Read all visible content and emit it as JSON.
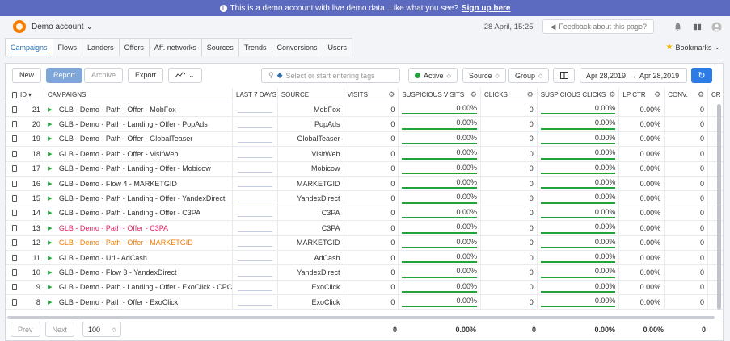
{
  "banner": {
    "text": "This is a demo account with live demo data. Like what you see?",
    "link": "Sign up here"
  },
  "topbar": {
    "account": "Demo account",
    "datetime": "28 April, 15:25",
    "feedback": "Feedback about this page?"
  },
  "tabs": [
    "Campaigns",
    "Flows",
    "Landers",
    "Offers",
    "Aff. networks",
    "Sources",
    "Trends",
    "Conversions",
    "Users"
  ],
  "bookmarks": "Bookmarks",
  "toolbar": {
    "new": "New",
    "report": "Report",
    "archive": "Archive",
    "export": "Export",
    "search_placeholder": "Select or start entering tags",
    "status": "Active",
    "source": "Source",
    "group": "Group",
    "date_from": "Apr 28,2019",
    "date_to": "Apr 28,2019"
  },
  "columns": {
    "id": "ID",
    "campaigns": "CAMPAIGNS",
    "last7": "LAST 7 DAYS",
    "source": "SOURCE",
    "visits": "VISITS",
    "susp_visits": "SUSPICIOUS VISITS",
    "clicks": "CLICKS",
    "susp_clicks": "SUSPICIOUS CLICKS",
    "lp_ctr": "LP CTR",
    "conv": "CONV.",
    "cr": "CR"
  },
  "rows": [
    {
      "id": "21",
      "name": "GLB - Demo - Path - Offer - MobFox",
      "source": "MobFox",
      "visits": "0",
      "susp_visits": "0.00%",
      "clicks": "0",
      "susp_clicks": "0.00%",
      "lp_ctr": "0.00%",
      "conv": "0",
      "color": ""
    },
    {
      "id": "20",
      "name": "GLB - Demo - Path - Landing - Offer - PopAds",
      "source": "PopAds",
      "visits": "0",
      "susp_visits": "0.00%",
      "clicks": "0",
      "susp_clicks": "0.00%",
      "lp_ctr": "0.00%",
      "conv": "0",
      "color": ""
    },
    {
      "id": "19",
      "name": "GLB - Demo - Path - Offer - GlobalTeaser",
      "source": "GlobalTeaser",
      "visits": "0",
      "susp_visits": "0.00%",
      "clicks": "0",
      "susp_clicks": "0.00%",
      "lp_ctr": "0.00%",
      "conv": "0",
      "color": ""
    },
    {
      "id": "18",
      "name": "GLB - Demo - Path - Offer - VisitWeb",
      "source": "VisitWeb",
      "visits": "0",
      "susp_visits": "0.00%",
      "clicks": "0",
      "susp_clicks": "0.00%",
      "lp_ctr": "0.00%",
      "conv": "0",
      "color": ""
    },
    {
      "id": "17",
      "name": "GLB - Demo - Path - Landing - Offer - Mobicow",
      "source": "Mobicow",
      "visits": "0",
      "susp_visits": "0.00%",
      "clicks": "0",
      "susp_clicks": "0.00%",
      "lp_ctr": "0.00%",
      "conv": "0",
      "color": ""
    },
    {
      "id": "16",
      "name": "GLB - Demo - Flow 4 - MARKETGID",
      "source": "MARKETGID",
      "visits": "0",
      "susp_visits": "0.00%",
      "clicks": "0",
      "susp_clicks": "0.00%",
      "lp_ctr": "0.00%",
      "conv": "0",
      "color": ""
    },
    {
      "id": "15",
      "name": "GLB - Demo - Path - Landing - Offer - YandexDirect",
      "source": "YandexDirect",
      "visits": "0",
      "susp_visits": "0.00%",
      "clicks": "0",
      "susp_clicks": "0.00%",
      "lp_ctr": "0.00%",
      "conv": "0",
      "color": ""
    },
    {
      "id": "14",
      "name": "GLB - Demo - Path - Landing - Offer - C3PA",
      "source": "C3PA",
      "visits": "0",
      "susp_visits": "0.00%",
      "clicks": "0",
      "susp_clicks": "0.00%",
      "lp_ctr": "0.00%",
      "conv": "0",
      "color": ""
    },
    {
      "id": "13",
      "name": "GLB - Demo - Path - Offer - C3PA",
      "source": "C3PA",
      "visits": "0",
      "susp_visits": "0.00%",
      "clicks": "0",
      "susp_clicks": "0.00%",
      "lp_ctr": "0.00%",
      "conv": "0",
      "color": "pink"
    },
    {
      "id": "12",
      "name": "GLB - Demo - Path - Offer - MARKETGID",
      "source": "MARKETGID",
      "visits": "0",
      "susp_visits": "0.00%",
      "clicks": "0",
      "susp_clicks": "0.00%",
      "lp_ctr": "0.00%",
      "conv": "0",
      "color": "orange"
    },
    {
      "id": "11",
      "name": "GLB - Demo - Url - AdCash",
      "source": "AdCash",
      "visits": "0",
      "susp_visits": "0.00%",
      "clicks": "0",
      "susp_clicks": "0.00%",
      "lp_ctr": "0.00%",
      "conv": "0",
      "color": ""
    },
    {
      "id": "10",
      "name": "GLB - Demo - Flow 3 - YandexDirect",
      "source": "YandexDirect",
      "visits": "0",
      "susp_visits": "0.00%",
      "clicks": "0",
      "susp_clicks": "0.00%",
      "lp_ctr": "0.00%",
      "conv": "0",
      "color": ""
    },
    {
      "id": "9",
      "name": "GLB - Demo - Path - Landing - Offer - ExoClick - CPC",
      "source": "ExoClick",
      "visits": "0",
      "susp_visits": "0.00%",
      "clicks": "0",
      "susp_clicks": "0.00%",
      "lp_ctr": "0.00%",
      "conv": "0",
      "color": ""
    },
    {
      "id": "8",
      "name": "GLB - Demo - Path - Offer - ExoClick",
      "source": "ExoClick",
      "visits": "0",
      "susp_visits": "0.00%",
      "clicks": "0",
      "susp_clicks": "0.00%",
      "lp_ctr": "0.00%",
      "conv": "0",
      "color": ""
    }
  ],
  "footer": {
    "prev": "Prev",
    "next": "Next",
    "page_size": "100",
    "visits": "0",
    "susp_visits": "0.00%",
    "clicks": "0",
    "susp_clicks": "0.00%",
    "lp_ctr": "0.00%",
    "conv": "0"
  },
  "colors": {
    "banner": "#5c6bc0",
    "accent": "#2d6fb5",
    "green": "#22a33a",
    "orange": "#f57c00",
    "pink": "#e91e63"
  }
}
